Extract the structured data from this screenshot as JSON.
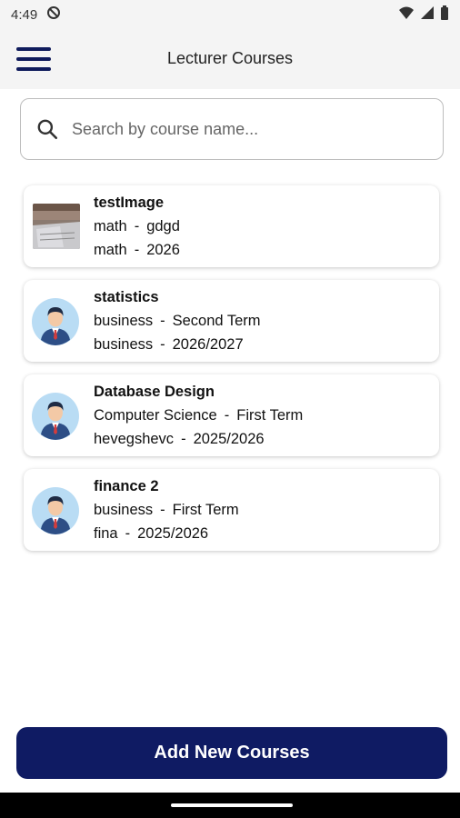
{
  "status": {
    "time": "4:49"
  },
  "header": {
    "title": "Lecturer Courses"
  },
  "search": {
    "placeholder": "Search by course name..."
  },
  "courses": [
    {
      "name": "testImage",
      "line2_a": "math",
      "line2_b": "gdgd",
      "line3_a": "math",
      "line3_b": "2026",
      "media": "course-photo"
    },
    {
      "name": "statistics",
      "line2_a": "business",
      "line2_b": "Second Term",
      "line3_a": "business",
      "line3_b": "2026/2027",
      "media": "person-avatar-icon"
    },
    {
      "name": "Database Design",
      "line2_a": "Computer Science",
      "line2_b": "First Term",
      "line3_a": "hevegshevc",
      "line3_b": "2025/2026",
      "media": "person-avatar-icon"
    },
    {
      "name": "finance 2",
      "line2_a": "business",
      "line2_b": "First Term",
      "line3_a": "fina",
      "line3_b": "2025/2026",
      "media": "person-avatar-icon"
    }
  ],
  "separator": "-",
  "actions": {
    "add_label": "Add New Courses"
  },
  "colors": {
    "primary": "#0f1b63",
    "appbar_bg": "#f4f4f4",
    "avatar_bg": "#b9dcf4"
  }
}
